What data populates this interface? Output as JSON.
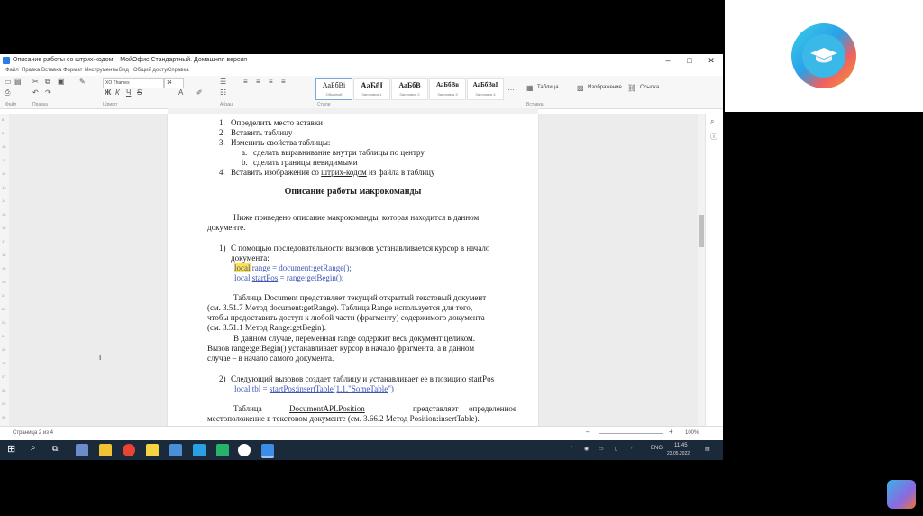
{
  "window": {
    "title": "Описание работы со штрих-кодом – МойОфис Стандартный. Домашняя версия",
    "min": "–",
    "max": "□",
    "close": "✕"
  },
  "menu": [
    "Файл",
    "Правка",
    "Вставка",
    "Формат",
    "Инструменты",
    "Вид",
    "Общий доступ",
    "Справка"
  ],
  "ribbon": {
    "font_name": "XO Thames",
    "font_size": "14",
    "groups": [
      "Файл",
      "Правка",
      "Шрифт",
      "Абзац",
      "Стили",
      "Вставка"
    ],
    "styles": [
      {
        "preview": "АаБбВі",
        "label": "Обычный"
      },
      {
        "preview": "АаБбІ",
        "label": "Заголовок 1"
      },
      {
        "preview": "АаБбВ",
        "label": "Заголовок 2"
      },
      {
        "preview": "АаБбВв",
        "label": "Заголовок 3"
      },
      {
        "preview": "АаБбВвІ",
        "label": "Заголовок 4"
      }
    ],
    "more": "…",
    "insert": {
      "table": "Таблица",
      "image": "Изображение",
      "link": "Ссылка"
    }
  },
  "vruler": [
    "8",
    "9",
    "10",
    "11",
    "12",
    "13",
    "14",
    "15",
    "16",
    "17",
    "18",
    "19",
    "20",
    "21",
    "22",
    "23",
    "24",
    "25",
    "26",
    "27",
    "28",
    "29",
    "30"
  ],
  "doc": {
    "list1": [
      {
        "num": "1.",
        "text": "Определить место вставки"
      },
      {
        "num": "2.",
        "text": "Вставить таблицу"
      },
      {
        "num": "3.",
        "text": "Изменить свойства таблицы:"
      },
      {
        "num": "a.",
        "text": "сделать выравнивание внутри таблицы по центру"
      },
      {
        "num": "b.",
        "text": "сделать границы невидимыми"
      },
      {
        "num": "4.",
        "text_pre": "Вставить изображения со ",
        "text_ul": "штрих-кодом",
        "text_post": " из файла в таблицу"
      }
    ],
    "heading": "Описание работы макрокоманды",
    "intro_1": "Ниже приведено описание макрокоманды, которая находится в данном",
    "intro_2": "документе.",
    "item1_num": "1)",
    "item1_1": "С помощью последовательности вызовов устанавливается курсор в начало",
    "item1_2": "документа:",
    "code1_local": "local",
    "code1_rest": " range = document:getRange();",
    "code2_local": "local",
    "code2_var": "startPos",
    "code2_rest": " = range:getBegin();",
    "p1_l1": "Таблица Document представляет текущий открытый текстовый документ",
    "p1_l2": "(см. 3.51.7 Метод document:getRange). Таблица Range используется для того,",
    "p1_l3": "чтобы предоставить доступ к любой части (фрагменту) содержимого документа",
    "p1_l4": "(см. 3.51.1 Метод Range:getBegin).",
    "p2_l1": "В данном случае, переменная range содержит весь документ целиком.",
    "p2_l2": "Вызов range:getBegin() устанавливает курсор в начало фрагмента, а в данном",
    "p2_l3": "случае – в начало самого документа.",
    "item2_num": "2)",
    "item2_1": "Следующий вызовов создает таблицу и устанавливает ее в позицию startPos",
    "code3_a": "local tbl = ",
    "code3_b": "startPos:insertTable(1,1,\"",
    "code3_c": "SomeTable",
    "code3_d": "\")",
    "p3_l1a": "Таблица",
    "p3_l1b": "DocumentAPI.Position",
    "p3_l1c": "представляет",
    "p3_l1d": "определенное",
    "p3_l2": "местоположение в текстовом документе (см. 3.66.2 Метод Position:insertTable)."
  },
  "status": {
    "page": "Страница 2 из 4",
    "zoom": "100%"
  },
  "taskbar": {
    "lang": "ENG",
    "time": "11:45",
    "date": "23.05.2022"
  },
  "colors": {
    "accent": "#2a7de1",
    "highlight": "#ffe24a",
    "code": "#3b54b5"
  }
}
